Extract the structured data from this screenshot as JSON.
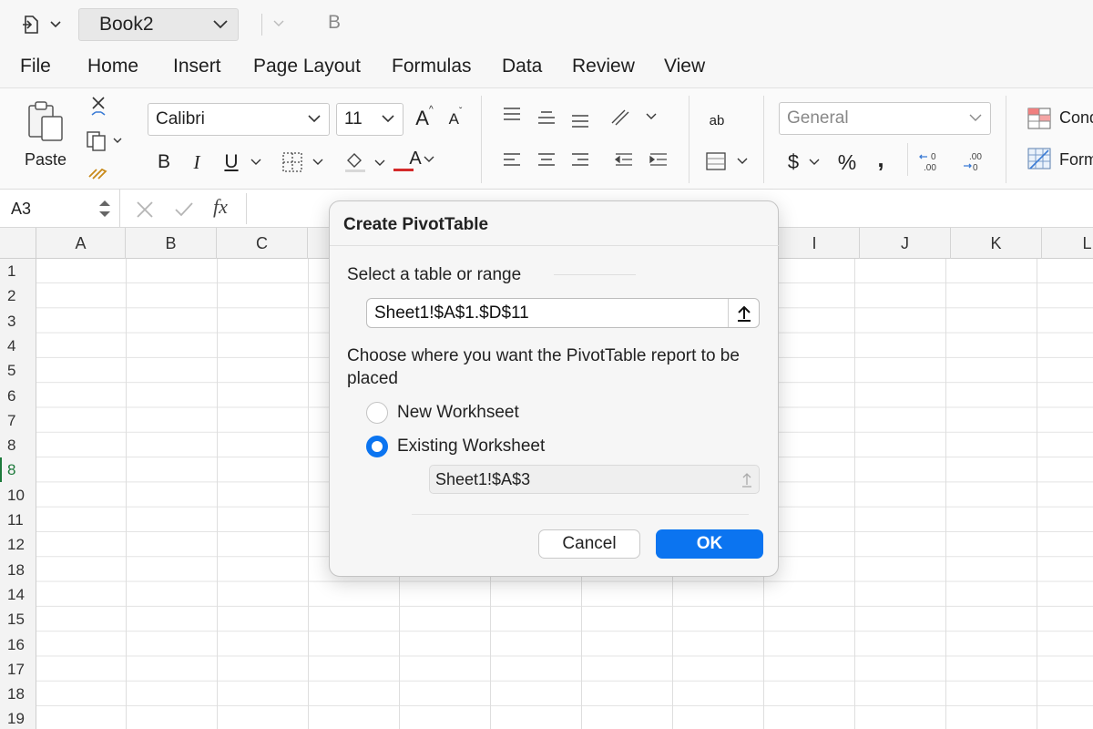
{
  "titlebar": {
    "document_name": "Book2",
    "bold_label": "B"
  },
  "menu": {
    "items": [
      "File",
      "Home",
      "Insert",
      "Page Layout",
      "Formulas",
      "Data",
      "Review",
      "View"
    ]
  },
  "ribbon": {
    "paste_label": "Paste",
    "font_name": "Calibri",
    "font_size": "11",
    "grow_font": "A",
    "shrink_font": "A",
    "bold": "B",
    "italic": "I",
    "underline": "U",
    "font_color_letter": "A",
    "wrap_text_glyph": "ab",
    "number_format": "General",
    "currency_symbol": "$",
    "percent_symbol": "%",
    "comma_symbol": ",",
    "conditional_formatting": "Cond",
    "format_as_table": "Form",
    "accent_red": "#d42a2a",
    "accent_green": "#1d7a3b"
  },
  "formula_bar": {
    "name_box": "A3",
    "fx_label": "fx",
    "value": ""
  },
  "grid": {
    "columns": [
      "A",
      "B",
      "C",
      "",
      "",
      "",
      "",
      "",
      "I",
      "J",
      "K",
      "L"
    ],
    "rows": [
      "1",
      "2",
      "3",
      "4",
      "5",
      "6",
      "7",
      "8",
      "8",
      "10",
      "11",
      "12",
      "18",
      "14",
      "15",
      "16",
      "17",
      "18",
      "19"
    ],
    "selected_row_index": 8
  },
  "dialog": {
    "title": "Create PivotTable",
    "range_label": "Select a table or range",
    "range_value": "Sheet1!$A$1.$D$11",
    "placement_label": "Choose where you want the PivotTable report to be placed",
    "option_new": "New Workhseet",
    "option_existing": "Existing Worksheet",
    "selected_option": "Existing Worksheet",
    "location_value": "Sheet1!$A$3",
    "cancel_label": "Cancel",
    "ok_label": "OK",
    "accent": "#0b74f0"
  }
}
